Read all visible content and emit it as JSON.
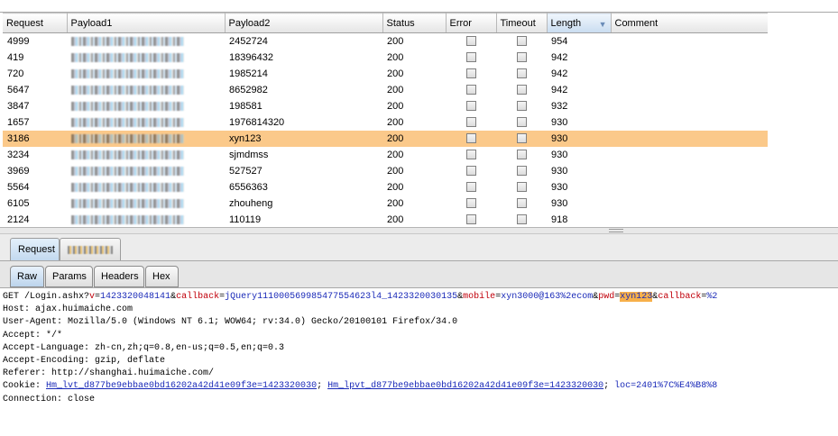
{
  "table": {
    "columns": [
      {
        "key": "request",
        "label": "Request"
      },
      {
        "key": "payload1",
        "label": "Payload1"
      },
      {
        "key": "payload2",
        "label": "Payload2"
      },
      {
        "key": "status",
        "label": "Status"
      },
      {
        "key": "error",
        "label": "Error"
      },
      {
        "key": "timeout",
        "label": "Timeout"
      },
      {
        "key": "length",
        "label": "Length"
      },
      {
        "key": "comment",
        "label": "Comment"
      }
    ],
    "sorted_column": "length",
    "rows": [
      {
        "request": "4999",
        "payload2": "2452724",
        "status": "200",
        "length": "954",
        "selected": false
      },
      {
        "request": "419",
        "payload2": "18396432",
        "status": "200",
        "length": "942",
        "selected": false
      },
      {
        "request": "720",
        "payload2": "1985214",
        "status": "200",
        "length": "942",
        "selected": false
      },
      {
        "request": "5647",
        "payload2": "8652982",
        "status": "200",
        "length": "942",
        "selected": false
      },
      {
        "request": "3847",
        "payload2": "198581",
        "status": "200",
        "length": "932",
        "selected": false
      },
      {
        "request": "1657",
        "payload2": "1976814320",
        "status": "200",
        "length": "930",
        "selected": false
      },
      {
        "request": "3186",
        "payload2": "xyn123",
        "status": "200",
        "length": "930",
        "selected": true
      },
      {
        "request": "3234",
        "payload2": "sjmdmss",
        "status": "200",
        "length": "930",
        "selected": false
      },
      {
        "request": "3969",
        "payload2": "527527",
        "status": "200",
        "length": "930",
        "selected": false
      },
      {
        "request": "5564",
        "payload2": "6556363",
        "status": "200",
        "length": "930",
        "selected": false
      },
      {
        "request": "6105",
        "payload2": "zhouheng",
        "status": "200",
        "length": "930",
        "selected": false
      },
      {
        "request": "2124",
        "payload2": "110119",
        "status": "200",
        "length": "918",
        "selected": false
      }
    ]
  },
  "outer_tabs": {
    "request": "Request",
    "response_obscured": true
  },
  "inner_tabs": [
    "Raw",
    "Params",
    "Headers",
    "Hex"
  ],
  "request_text": {
    "line1_prefix": "GET /Login.ashx?",
    "p_v": "v",
    "v_v": "1423320048141",
    "p_cb": "callback",
    "v_cb": "jQuery111000569985477554623l4_1423320030135",
    "p_mobile": "mobile",
    "v_mobile": "xyn3000@163%2ecom",
    "p_pwd": "pwd",
    "v_pwd": "xyn123",
    "p_cb2": "callback",
    "v_cb2": "%2",
    "host": "Host: ajax.huimaiche.com",
    "ua": "User-Agent: Mozilla/5.0 (Windows NT 6.1; WOW64; rv:34.0) Gecko/20100101 Firefox/34.0",
    "accept": "Accept: */*",
    "lang": "Accept-Language: zh-cn,zh;q=0.8,en-us;q=0.5,en;q=0.3",
    "enc": "Accept-Encoding: gzip, deflate",
    "ref": "Referer: http://shanghai.huimaiche.com/",
    "cookie_prefix": "Cookie: ",
    "c1": "Hm_lvt_d877be9ebbae0bd16202a42d41e09f3e=1423320030",
    "c2": "Hm_lpvt_d877be9ebbae0bd16202a42d41e09f3e=1423320030",
    "c3": "loc=2401%7C%E4%B8%8",
    "conn": "Connection: close"
  }
}
